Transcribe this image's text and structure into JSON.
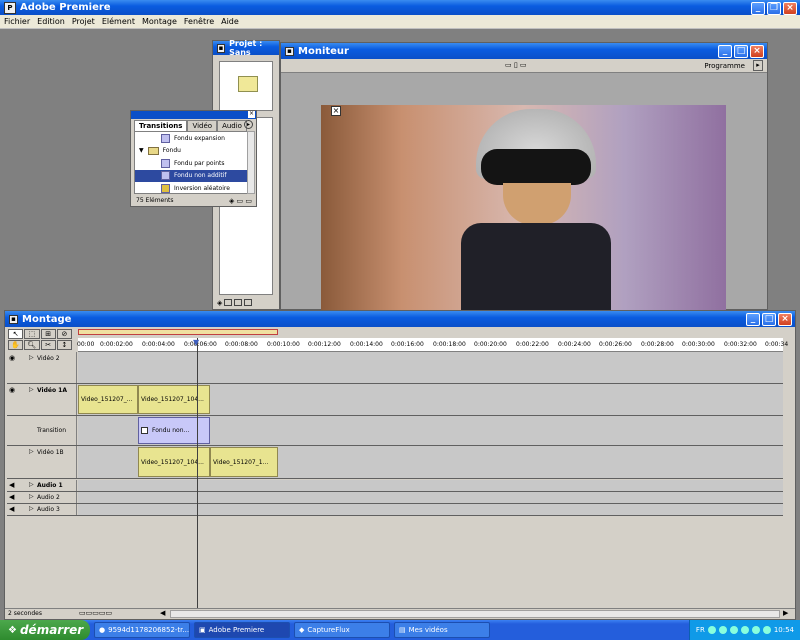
{
  "app": {
    "title": "Adobe Premiere"
  },
  "menu": [
    "Fichier",
    "Edition",
    "Projet",
    "Elément",
    "Montage",
    "Fenêtre",
    "Aide"
  ],
  "project_window": {
    "title": "Projet : Sans"
  },
  "monitor_window": {
    "title": "Moniteur",
    "mode": "Programme"
  },
  "transitions_palette": {
    "tabs": [
      "Transitions",
      "Vidéo",
      "Audio"
    ],
    "items": [
      {
        "label": "Fondu expansion",
        "kind": "transition",
        "selected": false
      },
      {
        "label": "Fondu",
        "kind": "folder",
        "selected": false
      },
      {
        "label": "Fondu par points",
        "kind": "transition",
        "selected": false
      },
      {
        "label": "Fondu non additif",
        "kind": "transition",
        "selected": true
      },
      {
        "label": "Inversion aléatoire",
        "kind": "transition",
        "selected": false
      }
    ],
    "count": "75 Eléments"
  },
  "montage_window": {
    "title": "Montage",
    "timecodes": [
      "00:00",
      "0:00:02:00",
      "0:00:04:00",
      "0:00:06:00",
      "0:00:08:00",
      "0:00:10:00",
      "0:00:12:00",
      "0:00:14:00",
      "0:00:16:00",
      "0:00:18:00",
      "0:00:20:00",
      "0:00:22:00",
      "0:00:24:00",
      "0:00:26:00",
      "0:00:28:00",
      "0:00:30:00",
      "0:00:32:00",
      "0:00:34"
    ],
    "tracks": {
      "video2": "Vidéo 2",
      "video1a": "Vidéo 1A",
      "transition": "Transition",
      "video1b": "Vidéo 1B",
      "audio1": "Audio 1",
      "audio2": "Audio 2",
      "audio3": "Audio 3"
    },
    "clips": {
      "v1a_1": "Video_151207_...",
      "v1a_2": "Video_151207_104...",
      "trans": "Fondu non...",
      "v1b_1": "Video_151207_104...",
      "v1b_2": "Video_151207_1..."
    },
    "zoom": "2 secondes"
  },
  "taskbar": {
    "start": "démarrer",
    "tasks": [
      "9594d1178206852-tr...",
      "Adobe Premiere",
      "CaptureFlux",
      "Mes vidéos"
    ],
    "lang": "FR",
    "clock": "10:54"
  },
  "colors": {
    "titlebar": "#0a5ce0",
    "selected": "#2d4aa0",
    "clip": "#e8e490",
    "transition_clip": "#c8c8f8"
  }
}
